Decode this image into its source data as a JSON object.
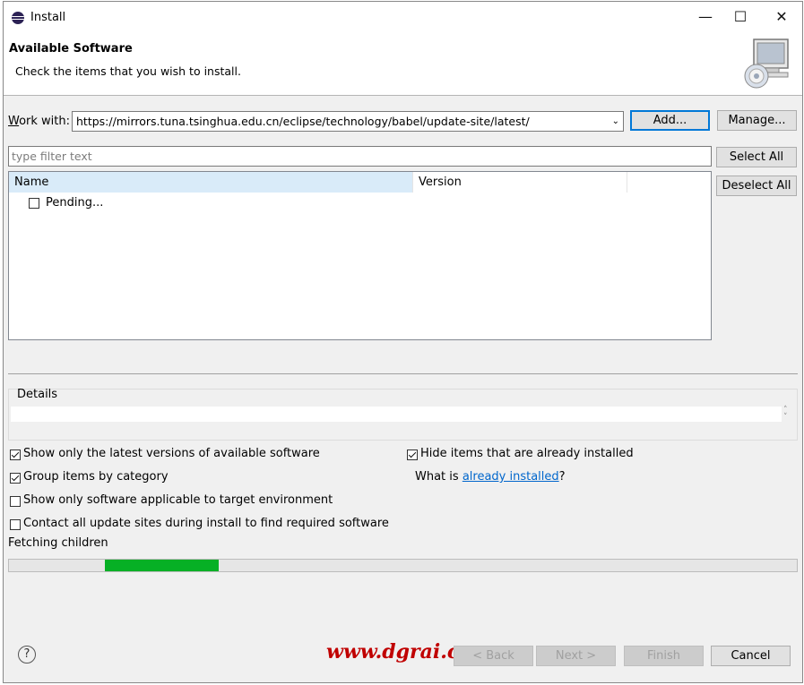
{
  "window": {
    "title": "Install",
    "controls": {
      "minimize": "—",
      "maximize": "☐",
      "close": "✕"
    }
  },
  "header": {
    "title": "Available Software",
    "subtitle": "Check the items that you wish to install."
  },
  "work_with": {
    "label": "Work with:",
    "value": "https://mirrors.tuna.tsinghua.edu.cn/eclipse/technology/babel/update-site/latest/",
    "add_button": "Add...",
    "manage_button": "Manage..."
  },
  "filter": {
    "placeholder": "type filter text"
  },
  "buttons": {
    "select_all": "Select All",
    "deselect_all": "Deselect All"
  },
  "table": {
    "columns": [
      "Name",
      "Version"
    ],
    "rows": [
      {
        "name": "Pending...",
        "checked": false
      }
    ]
  },
  "details": {
    "label": "Details"
  },
  "options": {
    "latest_versions": {
      "label": "Show only the latest versions of available software",
      "checked": true
    },
    "group_by_category": {
      "label": "Group items by category",
      "checked": true
    },
    "target_env": {
      "label": "Show only software applicable to target environment",
      "checked": false
    },
    "contact_sites": {
      "label": "Contact all update sites during install to find required software",
      "checked": false
    },
    "hide_installed": {
      "label": "Hide items that are already installed",
      "checked": true
    },
    "what_is": {
      "prefix": "What is ",
      "link": "already installed",
      "suffix": "?"
    }
  },
  "status": {
    "text": "Fetching children",
    "progress_indeterminate": true
  },
  "footer": {
    "help": "?",
    "watermark": "www.dgrai.com",
    "back": "< Back",
    "next": "Next >",
    "finish": "Finish",
    "cancel": "Cancel"
  },
  "colors": {
    "progress": "#06b025",
    "link": "#0066cc",
    "watermark": "#c00000",
    "accent": "#0078d7"
  }
}
